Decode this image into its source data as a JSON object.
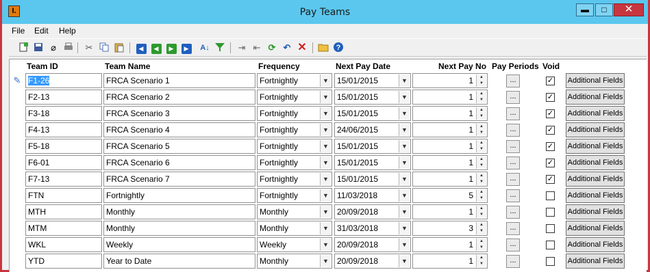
{
  "window": {
    "title": "Pay Teams",
    "app_icon": "app-logo-icon",
    "controls": {
      "minimize": "▬",
      "maximize": "□",
      "close": "✕"
    }
  },
  "menu": [
    "File",
    "Edit",
    "Help"
  ],
  "toolbar": {
    "icons": [
      "new-record-icon",
      "save-icon",
      "attach-icon",
      "print-icon",
      "cut-icon",
      "copy-icon",
      "paste-icon",
      "first-record-icon",
      "previous-record-icon",
      "next-record-icon",
      "last-record-icon",
      "sort-icon",
      "filter-icon",
      "indent-icon",
      "outdent-icon",
      "refresh-icon",
      "undo-icon",
      "delete-icon",
      "open-folder-icon",
      "help-icon"
    ]
  },
  "columns": {
    "team_id": "Team ID",
    "team_name": "Team Name",
    "frequency": "Frequency",
    "next_pay_date": "Next Pay Date",
    "next_pay_no": "Next Pay No",
    "pay_periods": "Pay Periods",
    "void": "Void"
  },
  "rows": [
    {
      "id": "F1-26",
      "name": "FRCA Scenario 1",
      "frequency": "Fortnightly",
      "date": "15/01/2015",
      "pay_no": "1",
      "void": true
    },
    {
      "id": "F2-13",
      "name": "FRCA Scenario 2",
      "frequency": "Fortnightly",
      "date": "15/01/2015",
      "pay_no": "1",
      "void": true
    },
    {
      "id": "F3-18",
      "name": "FRCA Scenario 3",
      "frequency": "Fortnightly",
      "date": "15/01/2015",
      "pay_no": "1",
      "void": true
    },
    {
      "id": "F4-13",
      "name": "FRCA Scenario 4",
      "frequency": "Fortnightly",
      "date": "24/06/2015",
      "pay_no": "1",
      "void": true
    },
    {
      "id": "F5-18",
      "name": "FRCA Scenario 5",
      "frequency": "Fortnightly",
      "date": "15/01/2015",
      "pay_no": "1",
      "void": true
    },
    {
      "id": "F6-01",
      "name": "FRCA Scenario 6",
      "frequency": "Fortnightly",
      "date": "15/01/2015",
      "pay_no": "1",
      "void": true
    },
    {
      "id": "F7-13",
      "name": "FRCA Scenario 7",
      "frequency": "Fortnightly",
      "date": "15/01/2015",
      "pay_no": "1",
      "void": true
    },
    {
      "id": "FTN",
      "name": "Fortnightly",
      "frequency": "Fortnightly",
      "date": "11/03/2018",
      "pay_no": "5",
      "void": false
    },
    {
      "id": "MTH",
      "name": "Monthly",
      "frequency": "Monthly",
      "date": "20/09/2018",
      "pay_no": "1",
      "void": false
    },
    {
      "id": "MTM",
      "name": "Monthly",
      "frequency": "Monthly",
      "date": "31/03/2018",
      "pay_no": "3",
      "void": false
    },
    {
      "id": "WKL",
      "name": "Weekly",
      "frequency": "Weekly",
      "date": "20/09/2018",
      "pay_no": "1",
      "void": false
    },
    {
      "id": "YTD",
      "name": "Year to Date",
      "frequency": "Monthly",
      "date": "20/09/2018",
      "pay_no": "1",
      "void": false
    }
  ],
  "labels": {
    "pay_periods_button": "...",
    "additional_fields": "Additional Fields",
    "checkmark": "✓"
  },
  "current_row_icon": "pencil-icon",
  "selected_row": 0
}
